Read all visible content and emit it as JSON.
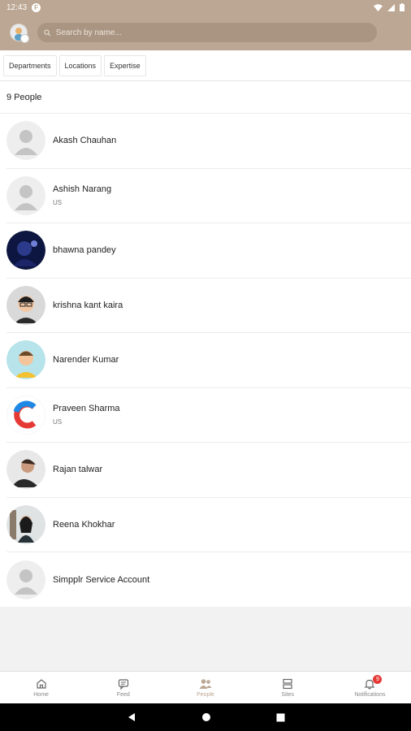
{
  "status": {
    "time": "12:43",
    "app_badge": "F"
  },
  "search": {
    "placeholder": "Search by name..."
  },
  "filters": [
    {
      "label": "Departments"
    },
    {
      "label": "Locations"
    },
    {
      "label": "Expertise"
    }
  ],
  "people_count_label": "9 People",
  "people": [
    {
      "name": "Akash Chauhan",
      "location": "",
      "avatar": "placeholder"
    },
    {
      "name": "Ashish Narang",
      "location": "US",
      "avatar": "placeholder"
    },
    {
      "name": "bhawna pandey",
      "location": "",
      "avatar": "photo-dark-blue"
    },
    {
      "name": "krishna kant kaira",
      "location": "",
      "avatar": "cartoon-glasses"
    },
    {
      "name": "Narender Kumar",
      "location": "",
      "avatar": "cartoon-yellow"
    },
    {
      "name": "Praveen Sharma",
      "location": "US",
      "avatar": "logo-c"
    },
    {
      "name": "Rajan talwar",
      "location": "",
      "avatar": "photo-dark"
    },
    {
      "name": "Reena Khokhar",
      "location": "",
      "avatar": "photo-woman"
    },
    {
      "name": "Simpplr Service Account",
      "location": "",
      "avatar": "placeholder"
    }
  ],
  "nav": {
    "home": "Home",
    "feed": "Feed",
    "people": "People",
    "sites": "Sites",
    "notifications": "Notifications",
    "notifications_badge": "9"
  },
  "colors": {
    "brand": "#bba793",
    "badge": "#e53935"
  }
}
